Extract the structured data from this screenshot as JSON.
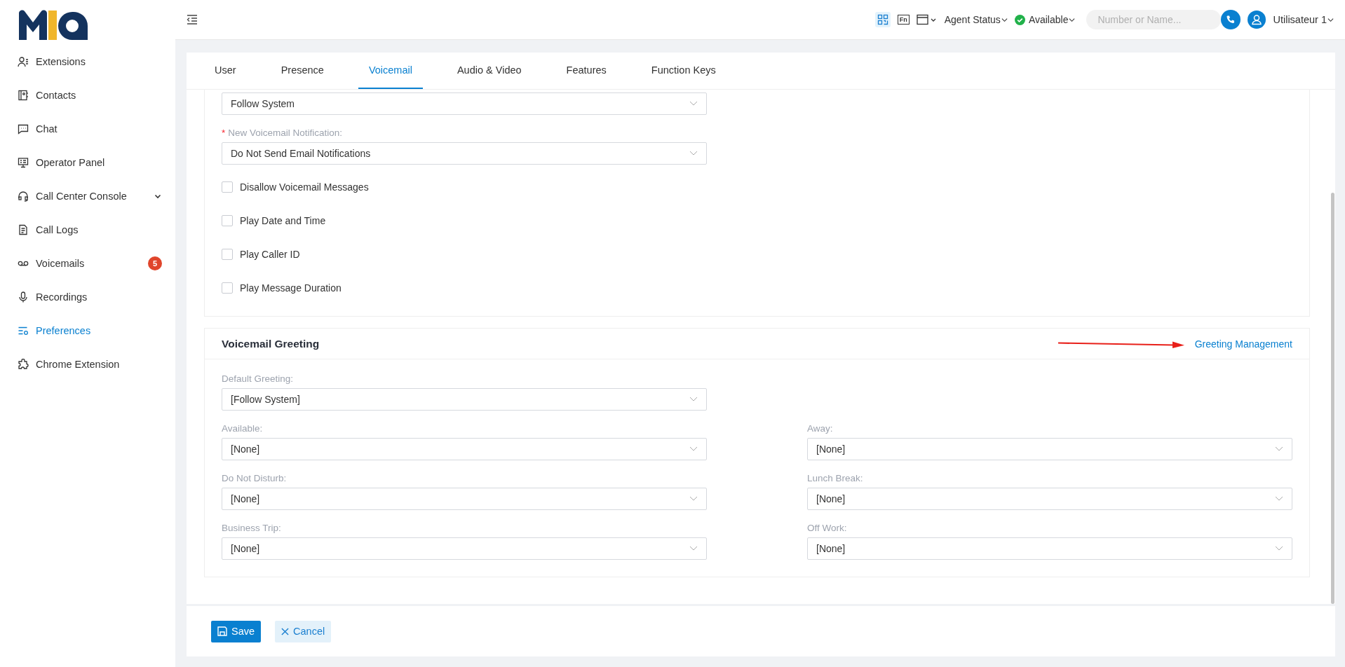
{
  "sidebar": {
    "items": [
      {
        "label": "Extensions",
        "selected": false
      },
      {
        "label": "Contacts",
        "selected": false
      },
      {
        "label": "Chat",
        "selected": false
      },
      {
        "label": "Operator Panel",
        "selected": false
      },
      {
        "label": "Call Center Console",
        "selected": false,
        "expanded": false
      },
      {
        "label": "Call Logs",
        "selected": false
      },
      {
        "label": "Voicemails",
        "selected": false,
        "badge": "5"
      },
      {
        "label": "Recordings",
        "selected": false
      },
      {
        "label": "Preferences",
        "selected": true
      },
      {
        "label": "Chrome Extension",
        "selected": false
      }
    ]
  },
  "topbar": {
    "fn_key": "Fn",
    "agent_status": "Agent Status",
    "presence": "Available",
    "search": {
      "placeholder": "Number or Name..."
    },
    "user": "Utilisateur 1"
  },
  "tabs": [
    {
      "label": "User",
      "selected": false
    },
    {
      "label": "Presence",
      "selected": false
    },
    {
      "label": "Voicemail",
      "selected": true
    },
    {
      "label": "Audio & Video",
      "selected": false
    },
    {
      "label": "Features",
      "selected": false
    },
    {
      "label": "Function Keys",
      "selected": false
    }
  ],
  "voicemail": {
    "first_select": {
      "value": "Follow System"
    },
    "notification": {
      "label": "New Voicemail Notification:",
      "required_mark": "*",
      "value": "Do Not Send Email Notifications"
    },
    "options": [
      {
        "label": "Disallow Voicemail Messages",
        "checked": false
      },
      {
        "label": "Play Date and Time",
        "checked": false
      },
      {
        "label": "Play Caller ID",
        "checked": false
      },
      {
        "label": "Play Message Duration",
        "checked": false
      }
    ]
  },
  "greeting": {
    "title": "Voicemail Greeting",
    "link": "Greeting Management",
    "default": {
      "label": "Default Greeting:",
      "value": "[Follow System]"
    },
    "fields": [
      {
        "label": "Available:",
        "value": "[None]"
      },
      {
        "label": "Away:",
        "value": "[None]"
      },
      {
        "label": "Do Not Disturb:",
        "value": "[None]"
      },
      {
        "label": "Lunch Break:",
        "value": "[None]"
      },
      {
        "label": "Business Trip:",
        "value": "[None]"
      },
      {
        "label": "Off Work:",
        "value": "[None]"
      }
    ]
  },
  "buttons": {
    "save": "Save",
    "cancel": "Cancel"
  }
}
